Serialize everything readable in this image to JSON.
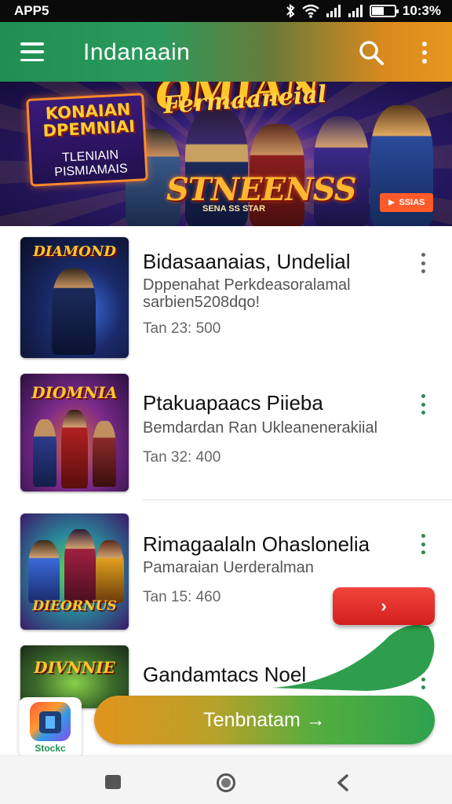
{
  "status_bar": {
    "left_label": "APP5",
    "time": "10:3%",
    "icons": [
      "bluetooth-icon",
      "wifi-icon",
      "signal-icon",
      "signal-icon",
      "battery-icon"
    ]
  },
  "app_bar": {
    "title": "Indanaain",
    "menu_icon": "hamburger-menu-icon",
    "search_icon": "search-icon",
    "more_icon": "more-vertical-icon",
    "gradient_colors": [
      "#1f8f52",
      "#e8961e"
    ]
  },
  "hero": {
    "title": "OMIAN",
    "subtitle": "Fermaaneial",
    "badge_title": "KONAIAN DPEMNIAI",
    "badge_sub": "TLENIAIN PISMIAMAIS",
    "stream_title": "STNEENSS",
    "stream_sub": "SENA SS STAR",
    "play_label": "SSIAS"
  },
  "items": [
    {
      "title": "Bidasaanaias, Undelial",
      "desc_line1": "Dppenahat Perkdeasoralamal",
      "desc_line2": "sarbien5208dqo!",
      "time": "Tan 23: 500",
      "thumb_label": "DIAMOND",
      "more_color": "#666666"
    },
    {
      "title": "Ptakuapaacs Piieba",
      "desc_line1": "Bemdardan Ran Ukleanenerakiial",
      "desc_line2": "",
      "time": "Tan 32: 400",
      "thumb_label": "DIOMNIA",
      "more_color": "#2e8b4e"
    },
    {
      "title": "Rimagaalaln Ohaslonelia",
      "desc_line1": "Pamaraian Uerderalman",
      "desc_line2": "",
      "time": "Tan 15: 460",
      "thumb_label": "DIEORNUS",
      "more_color": "#2e8b4e"
    },
    {
      "title": "Gandamtacs Noel",
      "desc_line1": "",
      "desc_line2": "",
      "time": "",
      "thumb_label": "DIVNNIE",
      "more_color": "#2e8b4e"
    }
  ],
  "floating_button": {
    "label": "›",
    "color": "#e0302a"
  },
  "cta": {
    "store_name": "Stockc",
    "button_label": "Tenbnatam →"
  },
  "nav": {
    "recent_icon": "recent-apps-icon",
    "home_icon": "home-icon",
    "back_icon": "back-icon"
  }
}
